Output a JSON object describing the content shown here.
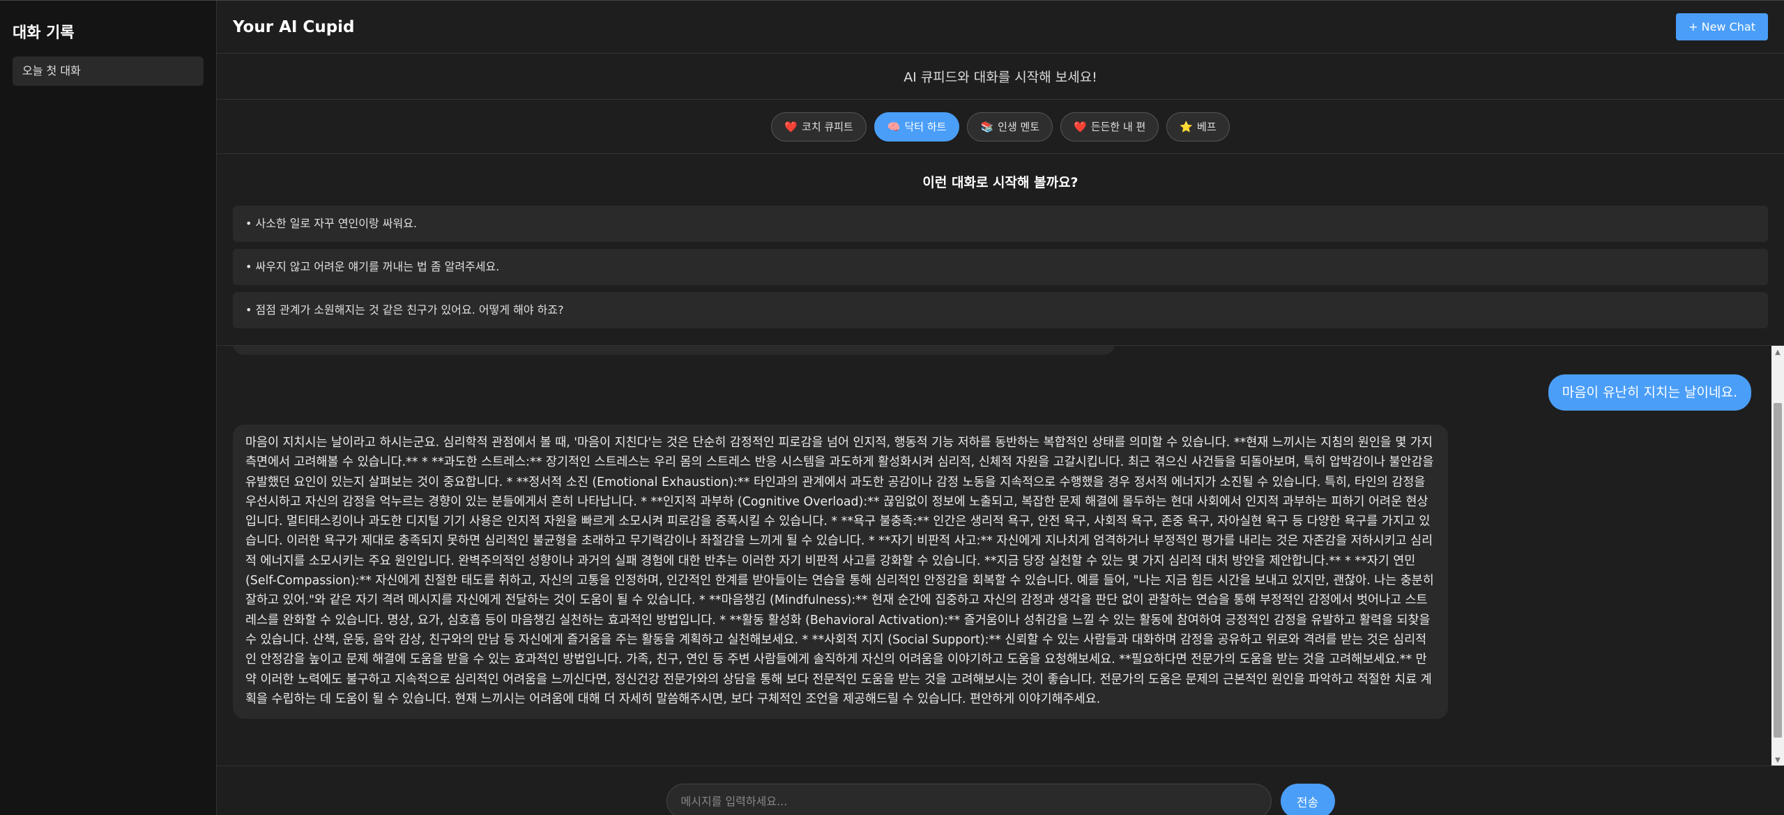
{
  "sidebar": {
    "title": "대화 기록",
    "items": [
      {
        "label": "오늘 첫 대화"
      }
    ]
  },
  "header": {
    "title": "Your AI Cupid",
    "new_chat_label": "+ New Chat"
  },
  "intro": {
    "text": "AI 큐피드와 대화를 시작해 보세요!"
  },
  "personas": [
    {
      "icon": "heart-icon",
      "glyph": "❤️",
      "label": "코치 큐피트",
      "active": false
    },
    {
      "icon": "brain-icon",
      "glyph": "🧠",
      "label": "닥터 하트",
      "active": true
    },
    {
      "icon": "books-icon",
      "glyph": "📚",
      "label": "인생 멘토",
      "active": false
    },
    {
      "icon": "heart-icon",
      "glyph": "❤️",
      "label": "든든한 내 편",
      "active": false
    },
    {
      "icon": "star-icon",
      "glyph": "⭐",
      "label": "베프",
      "active": false
    }
  ],
  "suggestions": {
    "title": "이런 대화로 시작해 볼까요?",
    "items": [
      "• 사소한 일로 자꾸 연인이랑 싸워요.",
      "• 싸우지 않고 어려운 얘기를 꺼내는 법 좀 알려주세요.",
      "• 점점 관계가 소원해지는 것 같은 친구가 있어요. 어떻게 해야 하죠?"
    ]
  },
  "chat": {
    "user_message": "마음이 유난히 지치는 날이네요.",
    "bot_message": "마음이 지치시는 날이라고 하시는군요. 심리학적 관점에서 볼 때, '마음이 지친다'는 것은 단순히 감정적인 피로감을 넘어 인지적, 행동적 기능 저하를 동반하는 복합적인 상태를 의미할 수 있습니다. **현재 느끼시는 지침의 원인을 몇 가지 측면에서 고려해볼 수 있습니다.** * **과도한 스트레스:** 장기적인 스트레스는 우리 몸의 스트레스 반응 시스템을 과도하게 활성화시켜 심리적, 신체적 자원을 고갈시킵니다. 최근 겪으신 사건들을 되돌아보며, 특히 압박감이나 불안감을 유발했던 요인이 있는지 살펴보는 것이 중요합니다. * **정서적 소진 (Emotional Exhaustion):** 타인과의 관계에서 과도한 공감이나 감정 노동을 지속적으로 수행했을 경우 정서적 에너지가 소진될 수 있습니다. 특히, 타인의 감정을 우선시하고 자신의 감정을 억누르는 경향이 있는 분들에게서 흔히 나타납니다. * **인지적 과부하 (Cognitive Overload):** 끊임없이 정보에 노출되고, 복잡한 문제 해결에 몰두하는 현대 사회에서 인지적 과부하는 피하기 어려운 현상입니다. 멀티태스킹이나 과도한 디지털 기기 사용은 인지적 자원을 빠르게 소모시켜 피로감을 증폭시킬 수 있습니다. * **욕구 불충족:** 인간은 생리적 욕구, 안전 욕구, 사회적 욕구, 존중 욕구, 자아실현 욕구 등 다양한 욕구를 가지고 있습니다. 이러한 욕구가 제대로 충족되지 못하면 심리적인 불균형을 초래하고 무기력감이나 좌절감을 느끼게 될 수 있습니다. * **자기 비판적 사고:** 자신에게 지나치게 엄격하거나 부정적인 평가를 내리는 것은 자존감을 저하시키고 심리적 에너지를 소모시키는 주요 원인입니다. 완벽주의적인 성향이나 과거의 실패 경험에 대한 반추는 이러한 자기 비판적 사고를 강화할 수 있습니다. **지금 당장 실천할 수 있는 몇 가지 심리적 대처 방안을 제안합니다.** * **자기 연민 (Self-Compassion):** 자신에게 친절한 태도를 취하고, 자신의 고통을 인정하며, 인간적인 한계를 받아들이는 연습을 통해 심리적인 안정감을 회복할 수 있습니다. 예를 들어, \"나는 지금 힘든 시간을 보내고 있지만, 괜찮아. 나는 충분히 잘하고 있어.\"와 같은 자기 격려 메시지를 자신에게 전달하는 것이 도움이 될 수 있습니다. * **마음챙김 (Mindfulness):** 현재 순간에 집중하고 자신의 감정과 생각을 판단 없이 관찰하는 연습을 통해 부정적인 감정에서 벗어나고 스트레스를 완화할 수 있습니다. 명상, 요가, 심호흡 등이 마음챙김 실천하는 효과적인 방법입니다. * **활동 활성화 (Behavioral Activation):** 즐거움이나 성취감을 느낄 수 있는 활동에 참여하여 긍정적인 감정을 유발하고 활력을 되찾을 수 있습니다. 산책, 운동, 음악 감상, 친구와의 만남 등 자신에게 즐거움을 주는 활동을 계획하고 실천해보세요. * **사회적 지지 (Social Support):** 신뢰할 수 있는 사람들과 대화하며 감정을 공유하고 위로와 격려를 받는 것은 심리적인 안정감을 높이고 문제 해결에 도움을 받을 수 있는 효과적인 방법입니다. 가족, 친구, 연인 등 주변 사람들에게 솔직하게 자신의 어려움을 이야기하고 도움을 요청해보세요. **필요하다면 전문가의 도움을 받는 것을 고려해보세요.** 만약 이러한 노력에도 불구하고 지속적으로 심리적인 어려움을 느끼신다면, 정신건강 전문가와의 상담을 통해 보다 전문적인 도움을 받는 것을 고려해보시는 것이 좋습니다. 전문가의 도움은 문제의 근본적인 원인을 파악하고 적절한 치료 계획을 수립하는 데 도움이 될 수 있습니다. 현재 느끼시는 어려움에 대해 더 자세히 말씀해주시면, 보다 구체적인 조언을 제공해드릴 수 있습니다. 편안하게 이야기해주세요."
  },
  "input": {
    "placeholder": "메시지를 입력하세요...",
    "send_label": "전송"
  },
  "colors": {
    "accent": "#4a9ef8",
    "background": "#1e1e1e",
    "sidebar": "#141414",
    "bubble": "#2a2a2a"
  }
}
